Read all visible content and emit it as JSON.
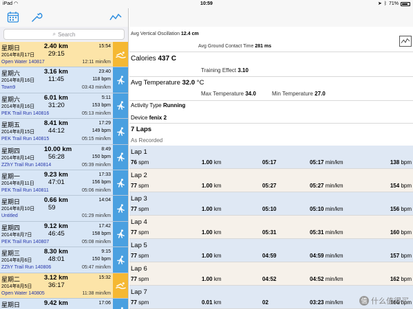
{
  "status": {
    "device": "iPad",
    "time": "10:59",
    "battery": "71%"
  },
  "search": {
    "placeholder": "Search"
  },
  "activities": [
    {
      "day": "星期日",
      "dist": "2.40 km",
      "time_of_day": "15:54",
      "date": "2014年8月17日",
      "duration": "29:15",
      "hr": "",
      "name": "Open Water 140817",
      "pace": "12:11 min/km",
      "type": "swim"
    },
    {
      "day": "星期六",
      "dist": "3.16 km",
      "time_of_day": "23:40",
      "date": "2014年8月16日",
      "duration": "11:45",
      "hr": "118 bpm",
      "name": "Town9",
      "pace": "03:43 min/km",
      "type": "run"
    },
    {
      "day": "星期六",
      "dist": "6.01 km",
      "time_of_day": "5:11",
      "date": "2014年8月16日",
      "duration": "31:20",
      "hr": "153 bpm",
      "name": "PEK Trail Run 140816",
      "pace": "05:13 min/km",
      "type": "run"
    },
    {
      "day": "星期五",
      "dist": "8.41 km",
      "time_of_day": "17:29",
      "date": "2014年8月15日",
      "duration": "44:12",
      "hr": "149 bpm",
      "name": "PEK Trail Run 140815",
      "pace": "05:15 min/km",
      "type": "run"
    },
    {
      "day": "星期四",
      "dist": "10.00 km",
      "time_of_day": "8:49",
      "date": "2014年8月14日",
      "duration": "56:28",
      "hr": "150 bpm",
      "name": "ZZhY Trail Run 140814",
      "pace": "05:39 min/km",
      "type": "run"
    },
    {
      "day": "星期一",
      "dist": "9.23 km",
      "time_of_day": "17:33",
      "date": "2014年8月11日",
      "duration": "47:01",
      "hr": "156 bpm",
      "name": "PEK Trail Run 140811",
      "pace": "05:06 min/km",
      "type": "run"
    },
    {
      "day": "星期日",
      "dist": "0.66 km",
      "time_of_day": "14:04",
      "date": "2014年8月10日",
      "duration": "59",
      "hr": "",
      "name": "Untitled",
      "pace": "01:29 min/km",
      "type": "run"
    },
    {
      "day": "星期四",
      "dist": "9.12 km",
      "time_of_day": "17:42",
      "date": "2014年8月7日",
      "duration": "46:45",
      "hr": "158 bpm",
      "name": "PEK Trail Run 140807",
      "pace": "05:08 min/km",
      "type": "run"
    },
    {
      "day": "星期三",
      "dist": "8.30 km",
      "time_of_day": "9:15",
      "date": "2014年8月6日",
      "duration": "48:01",
      "hr": "150 bpm",
      "name": "ZZhY Trail Run 140806",
      "pace": "05:47 min/km",
      "type": "run"
    },
    {
      "day": "星期二",
      "dist": "3.12 km",
      "time_of_day": "15:32",
      "date": "2014年8月5日",
      "duration": "36:17",
      "hr": "",
      "name": "Open Water 140805",
      "pace": "11:38 min/km",
      "type": "swim"
    },
    {
      "day": "星期日",
      "dist": "9.42 km",
      "time_of_day": "17:06",
      "date": "",
      "duration": "",
      "hr": "",
      "name": "",
      "pace": "",
      "type": "run"
    }
  ],
  "detail": {
    "vertical_osc_label": "Avg Vertical Oscillation",
    "vertical_osc_value": "12.4 cm",
    "gct_label": "Avg Ground Contact Time",
    "gct_value": "281 ms",
    "calories_label": "Calories",
    "calories_value": "437 C",
    "te_label": "Training Effect",
    "te_value": "3.10",
    "avg_temp_label": "Avg Temperature",
    "avg_temp_value": "32.0",
    "avg_temp_unit": "°C",
    "max_temp_label": "Max Temperature",
    "max_temp_value": "34.0",
    "min_temp_label": "Min Temperature",
    "min_temp_value": "27.0",
    "activity_type_label": "Activity Type",
    "activity_type_value": "Running",
    "device_label": "Device",
    "device_value": "fenix 2",
    "laps_title": "7 Laps",
    "as_recorded": "As Recorded"
  },
  "laps": [
    {
      "label": "Lap 1",
      "cadence": "76",
      "dist": "1.00",
      "time": "05:17",
      "pace": "05:17",
      "hr": "138"
    },
    {
      "label": "Lap 2",
      "cadence": "77",
      "dist": "1.00",
      "time": "05:27",
      "pace": "05:27",
      "hr": "154"
    },
    {
      "label": "Lap 3",
      "cadence": "77",
      "dist": "1.00",
      "time": "05:10",
      "pace": "05:10",
      "hr": "156"
    },
    {
      "label": "Lap 4",
      "cadence": "77",
      "dist": "1.00",
      "time": "05:31",
      "pace": "05:31",
      "hr": "160"
    },
    {
      "label": "Lap 5",
      "cadence": "77",
      "dist": "1.00",
      "time": "04:59",
      "pace": "04:59",
      "hr": "157"
    },
    {
      "label": "Lap 6",
      "cadence": "77",
      "dist": "1.00",
      "time": "04:52",
      "pace": "04:52",
      "hr": "162"
    },
    {
      "label": "Lap 7",
      "cadence": "77",
      "dist": "0.01",
      "time": "02",
      "pace": "03:23",
      "hr": "166"
    }
  ],
  "units": {
    "spm": "spm",
    "km": "km",
    "pace": "min/km",
    "bpm": "bpm"
  },
  "watermark": {
    "text": "什么值得买",
    "glyph": "值"
  },
  "colors": {
    "run_tile": "#4aa0e0",
    "swim_tile": "#f5b833",
    "accent": "#2a8ce0"
  }
}
